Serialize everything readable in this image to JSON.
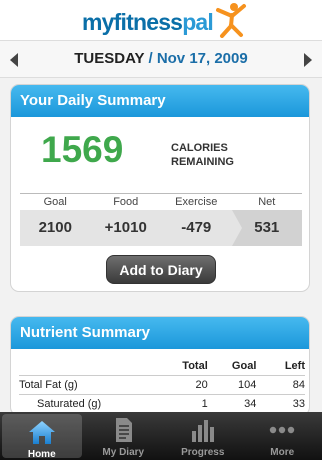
{
  "app": {
    "logo_part1": "myfitness",
    "logo_part2": "pal"
  },
  "date_nav": {
    "day": "TUESDAY",
    "separator": " / ",
    "date": "Nov 17, 2009",
    "prev_icon": "triangle-left",
    "next_icon": "triangle-right"
  },
  "summary": {
    "title": "Your Daily Summary",
    "calories_remaining": "1569",
    "calories_label_line1": "CALORIES",
    "calories_label_line2": "REMAINING",
    "columns": [
      "Goal",
      "Food",
      "Exercise",
      "Net"
    ],
    "values": [
      "2100",
      "+1010",
      "-479",
      "531"
    ],
    "add_button": "Add to Diary"
  },
  "nutrients": {
    "title": "Nutrient Summary",
    "headers": [
      "",
      "Total",
      "Goal",
      "Left"
    ],
    "rows": [
      {
        "name": "Total Fat (g)",
        "total": "20",
        "goal": "104",
        "left": "84"
      },
      {
        "name": "Saturated (g)",
        "total": "1",
        "goal": "34",
        "left": "33"
      }
    ]
  },
  "tabs": [
    {
      "label": "Home",
      "icon": "home-icon",
      "active": true
    },
    {
      "label": "My Diary",
      "icon": "diary-icon",
      "active": false
    },
    {
      "label": "Progress",
      "icon": "progress-chart-icon",
      "active": false
    },
    {
      "label": "More",
      "icon": "more-dots-icon",
      "active": false
    }
  ],
  "colors": {
    "accent_blue": "#1b97da",
    "calorie_green": "#3fa84c",
    "date_blue": "#1b6ea8"
  }
}
